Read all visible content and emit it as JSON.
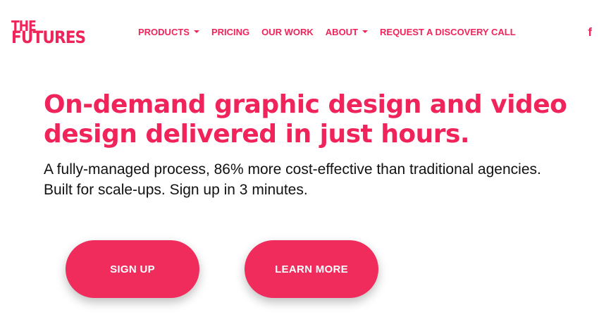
{
  "logo": {
    "line1": "THE",
    "line2": "FUTURES"
  },
  "nav": {
    "items": [
      {
        "label": "PRODUCTS",
        "dropdown": true
      },
      {
        "label": "PRICING",
        "dropdown": false
      },
      {
        "label": "OUR WORK",
        "dropdown": false
      },
      {
        "label": "ABOUT",
        "dropdown": true
      },
      {
        "label": "REQUEST A DISCOVERY CALL",
        "dropdown": false
      }
    ],
    "social_icon": "f"
  },
  "hero": {
    "headline": "On-demand graphic design and video design delivered in just hours.",
    "subtext": "A fully-managed process, 86% more cost-effective than traditional agencies. Built for scale-ups. Sign up in 3 minutes.",
    "signup_label": "SIGN UP",
    "learn_label": "LEARN MORE"
  },
  "colors": {
    "accent": "#f0245a",
    "text": "#111111",
    "background": "#ffffff"
  }
}
